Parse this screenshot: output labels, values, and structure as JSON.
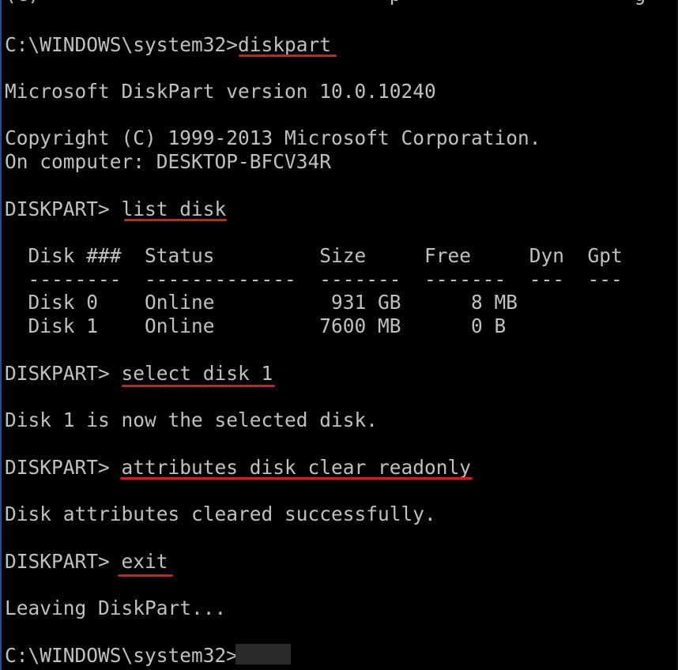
{
  "colors": {
    "background": "#000000",
    "text": "#c0c0c0",
    "annotation": "#d81b1b"
  },
  "top_cut": "(c)                              p                    g",
  "lines": {
    "prompt1": "C:\\WINDOWS\\system32>",
    "cmd1": "diskpart",
    "version": "Microsoft DiskPart version 10.0.10240",
    "copyright": "Copyright (C) 1999-2013 Microsoft Corporation.",
    "computer": "On computer: DESKTOP-BFCV34R",
    "prompt2": "DISKPART> ",
    "cmd2": "list disk",
    "prompt3": "DISKPART> ",
    "cmd3": "select disk 1",
    "selected_msg": "Disk 1 is now the selected disk.",
    "prompt4": "DISKPART> ",
    "cmd4": "attributes disk clear readonly",
    "cleared_msg": "Disk attributes cleared successfully.",
    "prompt5": "DISKPART> ",
    "cmd5": "exit",
    "leaving_msg": "Leaving DiskPart...",
    "prompt6": "C:\\WINDOWS\\system32>"
  },
  "disk_table": {
    "header": "  Disk ###  Status         Size     Free     Dyn  Gpt",
    "separator": "  --------  -------------  -------  -------  ---  ---",
    "rows": [
      "  Disk 0    Online          931 GB      8 MB",
      "  Disk 1    Online         7600 MB      0 B"
    ]
  }
}
